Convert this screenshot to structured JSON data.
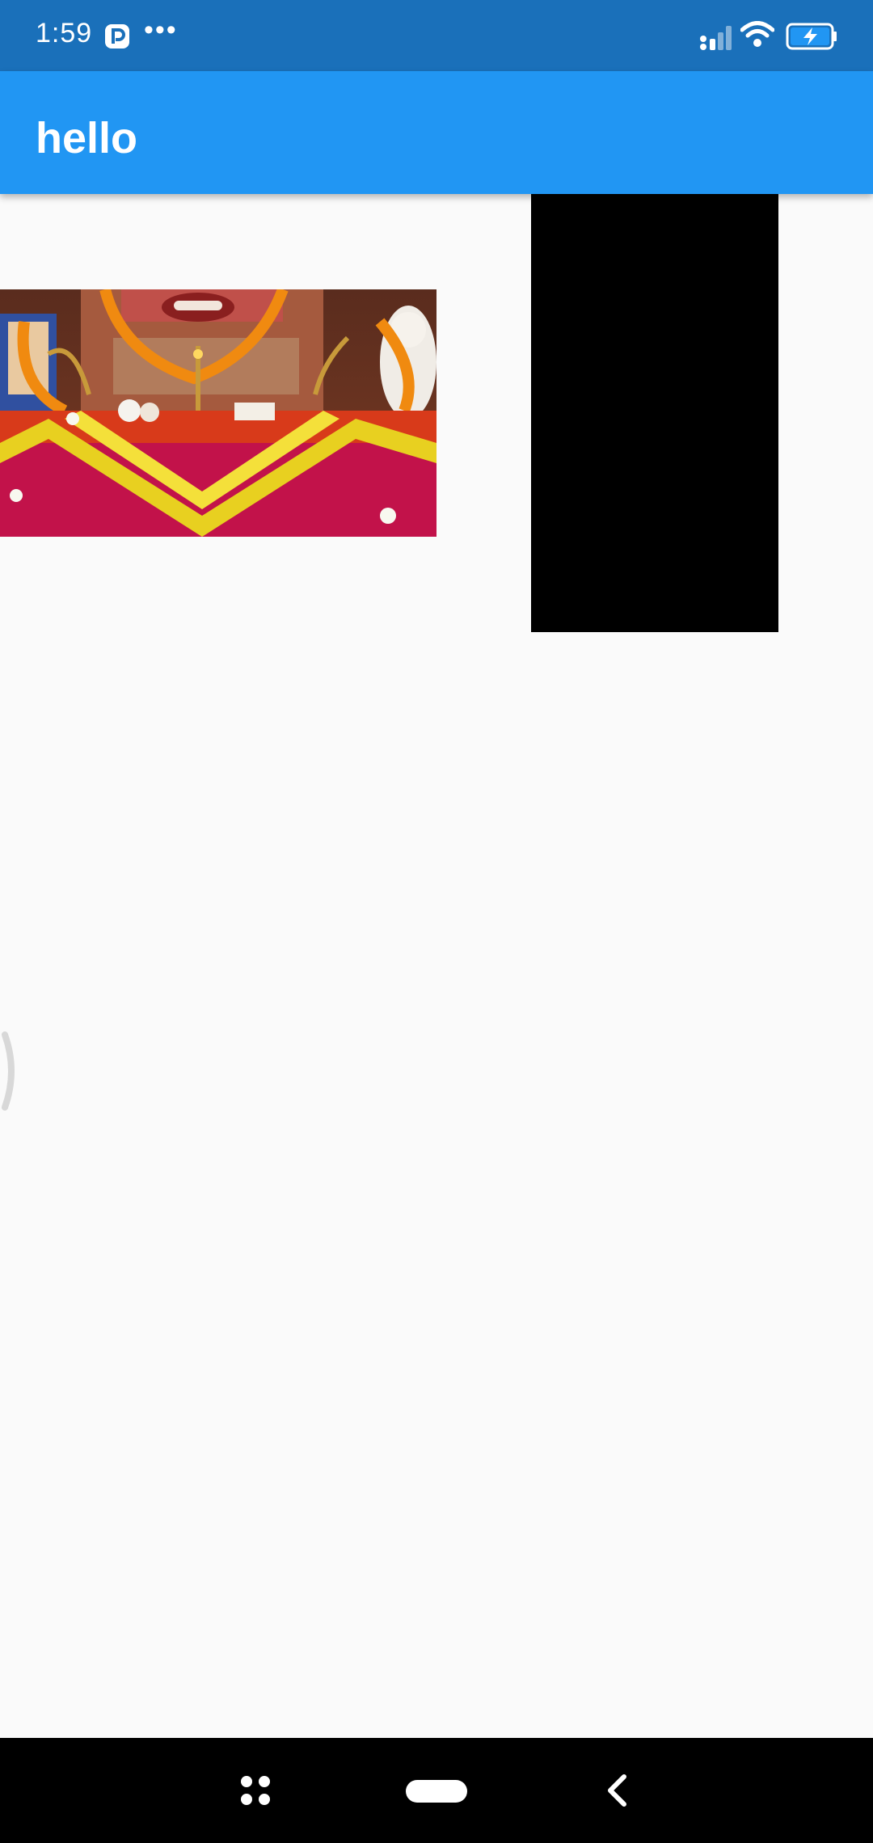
{
  "status_bar": {
    "time": "1:59",
    "overflow": "•••",
    "icons": [
      "app-p-icon",
      "signal-icon",
      "wifi-icon",
      "battery-charging-icon"
    ]
  },
  "app_bar": {
    "title": "hello"
  },
  "content": {
    "items": [
      {
        "type": "video-thumbnail",
        "description_icon": "shrine-thumbnail"
      },
      {
        "type": "video-player",
        "state": "black"
      }
    ]
  },
  "nav_bar": {
    "icons": [
      "recents-icon",
      "home-pill-icon",
      "back-icon"
    ]
  },
  "colors": {
    "status_bar": "#1A70BA",
    "app_bar": "#2196F3",
    "background": "#FAFAFA",
    "nav_bar": "#000000"
  }
}
